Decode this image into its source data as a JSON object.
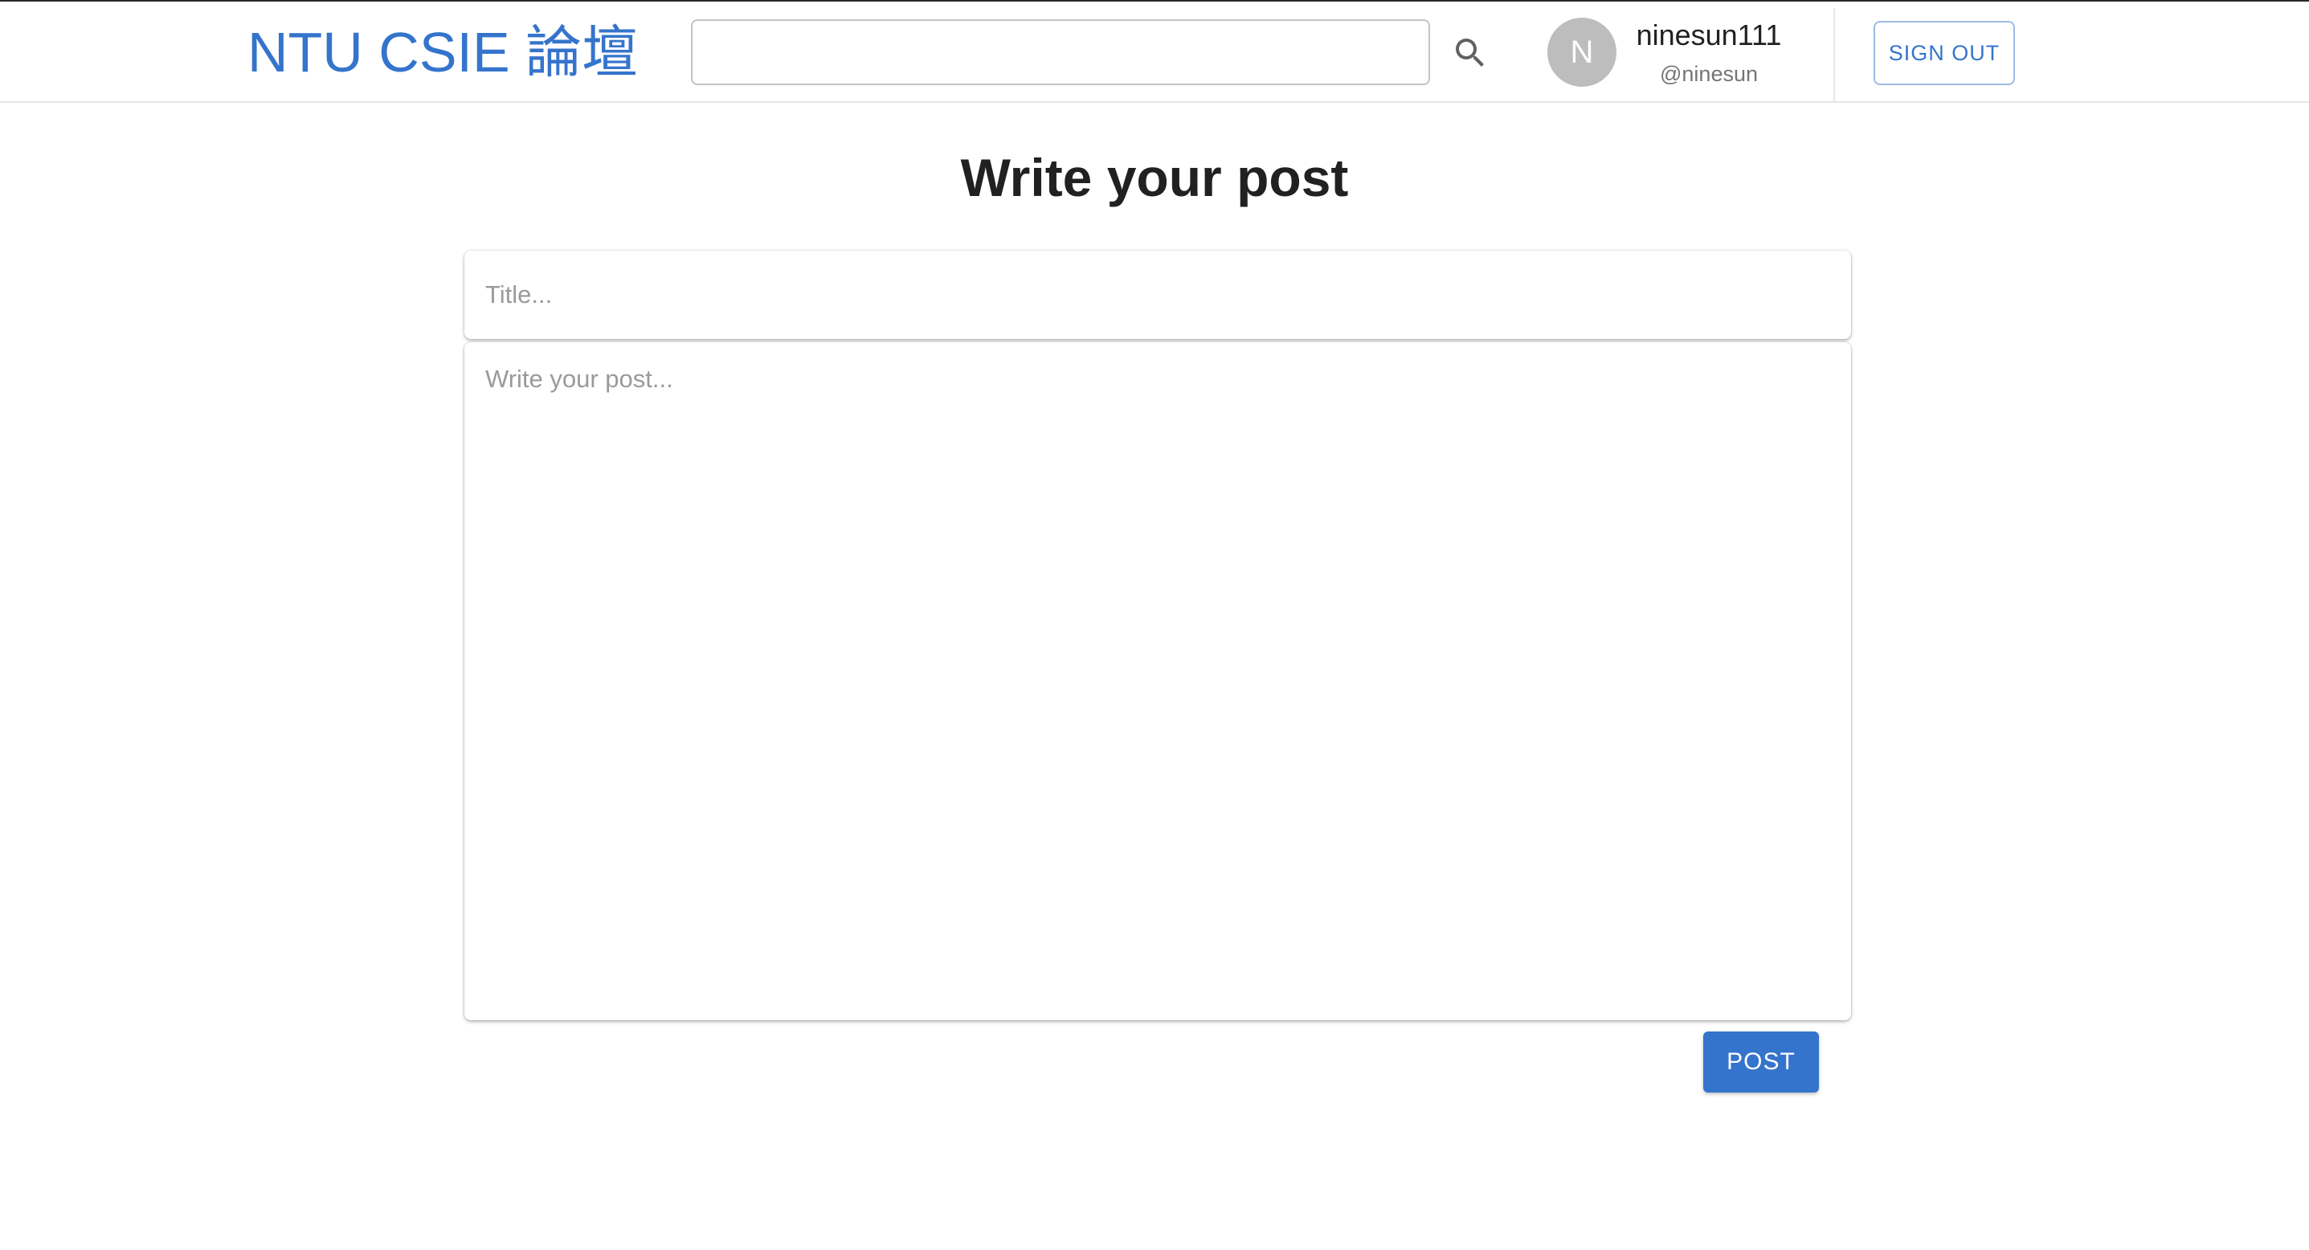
{
  "header": {
    "brand": "NTU CSIE 論壇",
    "search": {
      "value": "",
      "placeholder": "",
      "icon": "search-icon"
    },
    "user": {
      "avatar_initial": "N",
      "display_name": "ninesun111",
      "handle": "@ninesun"
    },
    "sign_out_label": "SIGN OUT"
  },
  "main": {
    "page_title": "Write your post",
    "title_field": {
      "value": "",
      "placeholder": "Title..."
    },
    "body_field": {
      "value": "",
      "placeholder": "Write your post..."
    },
    "post_label": "POST"
  },
  "colors": {
    "accent": "#3574cc",
    "avatar_bg": "#bdbdbd",
    "placeholder_text": "#9a9a9a"
  }
}
